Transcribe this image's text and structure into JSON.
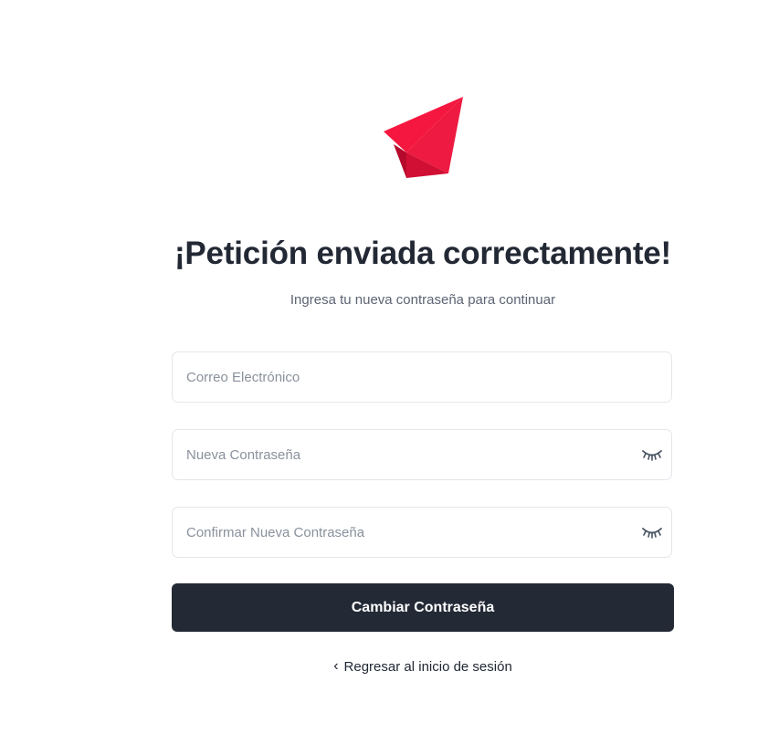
{
  "logo": {
    "icon": "paper-plane-icon",
    "color": "#f5173f"
  },
  "header": {
    "title": "¡Petición enviada correctamente!",
    "subtitle": "Ingresa tu nueva contraseña para continuar"
  },
  "form": {
    "email": {
      "placeholder": "Correo Electrónico",
      "value": ""
    },
    "new_password": {
      "placeholder": "Nueva Contraseña",
      "value": "",
      "toggle_icon": "eye-closed-icon"
    },
    "confirm_password": {
      "placeholder": "Confirmar Nueva Contraseña",
      "value": "",
      "toggle_icon": "eye-closed-icon"
    },
    "submit_label": "Cambiar Contraseña"
  },
  "footer": {
    "back_icon": "chevron-left-icon",
    "back_label": "Regresar al inicio de sesión"
  },
  "colors": {
    "accent": "#f5173f",
    "button_bg": "#232a35",
    "text": "#222834",
    "muted": "#5d6473"
  }
}
